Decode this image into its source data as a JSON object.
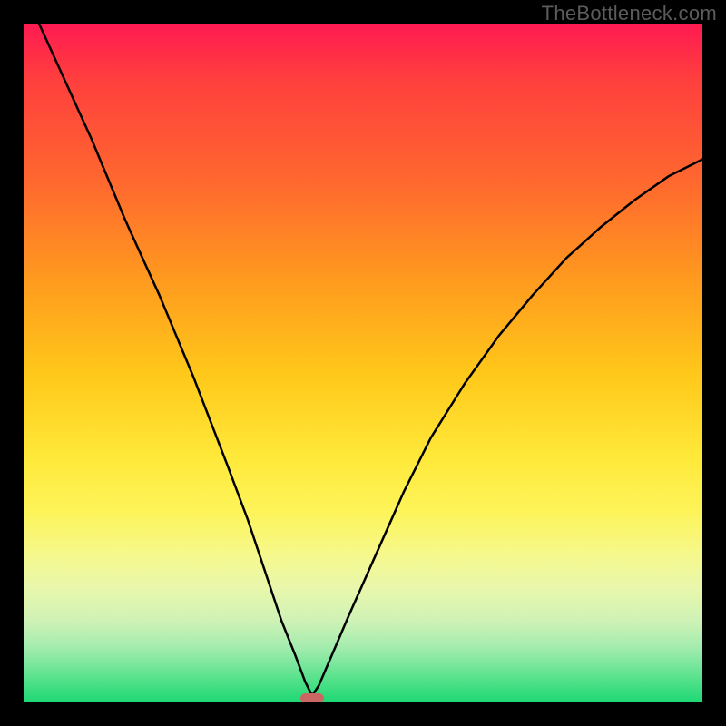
{
  "watermark": "TheBottleneck.com",
  "chart_data": {
    "type": "line",
    "title": "",
    "xlabel": "",
    "ylabel": "",
    "xlim": [
      0,
      100
    ],
    "ylim": [
      0,
      100
    ],
    "grid": false,
    "legend": false,
    "background_gradient": {
      "top": "#ff1a52",
      "bottom": "#1cd873",
      "meaning": "red=high bottleneck, green=low bottleneck"
    },
    "series": [
      {
        "name": "bottleneck-curve",
        "color": "#000000",
        "x": [
          0,
          5,
          10,
          15,
          20,
          25,
          30,
          33,
          36,
          38,
          40,
          41.5,
          42.5,
          43.5,
          45,
          48,
          52,
          56,
          60,
          65,
          70,
          75,
          80,
          85,
          90,
          95,
          100
        ],
        "y": [
          105,
          94,
          83,
          71,
          60,
          48,
          35,
          27,
          18,
          12,
          7,
          3,
          1,
          2.5,
          6,
          13,
          22,
          31,
          39,
          47,
          54,
          60,
          65.5,
          70,
          74,
          77.5,
          80
        ]
      }
    ],
    "marker": {
      "name": "optimal-point",
      "x": 42.5,
      "y": 0.6,
      "width_pct": 3.4,
      "height_pct": 1.6,
      "color": "#cb6762"
    }
  }
}
